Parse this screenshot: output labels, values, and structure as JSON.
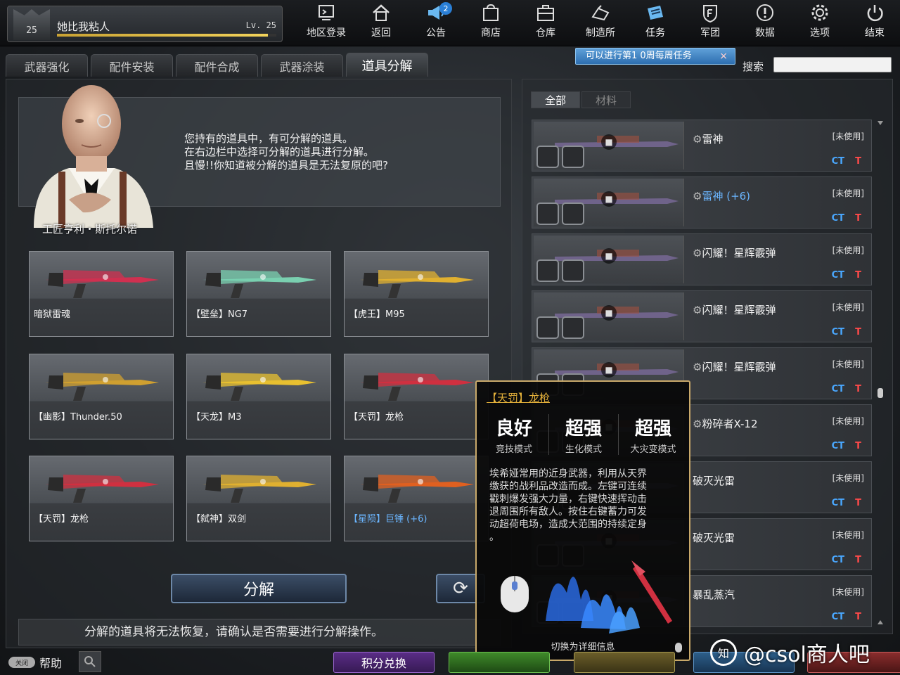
{
  "player": {
    "rank": "25",
    "name": "她比我粘人",
    "level": "Lv. 25",
    "xp_fraction": 0.96
  },
  "nav": [
    {
      "label": "地区登录",
      "icon": "server-login-icon"
    },
    {
      "label": "返回",
      "icon": "home-icon"
    },
    {
      "label": "公告",
      "icon": "megaphone-icon",
      "badge": "2"
    },
    {
      "label": "商店",
      "icon": "shop-icon"
    },
    {
      "label": "仓库",
      "icon": "inventory-icon"
    },
    {
      "label": "制造所",
      "icon": "crafting-icon"
    },
    {
      "label": "任务",
      "icon": "mission-icon"
    },
    {
      "label": "军团",
      "icon": "clan-icon"
    },
    {
      "label": "数据",
      "icon": "info-icon"
    },
    {
      "label": "选项",
      "icon": "gear-icon"
    },
    {
      "label": "结束",
      "icon": "power-icon"
    }
  ],
  "notice": {
    "text": "可以进行第1 0周每周任务",
    "close": "×"
  },
  "search": {
    "label": "搜索",
    "placeholder": ""
  },
  "subtabs": [
    "武器强化",
    "配件安装",
    "配件合成",
    "武器涂装",
    "道具分解"
  ],
  "npc": {
    "name": "工匠亨利・斯托尔诺",
    "lines": [
      "您持有的道具中，有可分解的道具。",
      "在右边栏中选择可分解的道具进行分解。",
      "且慢!!你知道被分解的道具是无法复原的吧?"
    ]
  },
  "items": [
    {
      "name": "暗狱雷魂",
      "color": "#d03050",
      "blue": false
    },
    {
      "name": "【壁垒】NG7",
      "color": "#7ad0b0",
      "blue": false
    },
    {
      "name": "【虎王】M95",
      "color": "#e0b030",
      "blue": false
    },
    {
      "name": "【幽影】Thunder.50",
      "color": "#d0a030",
      "blue": false
    },
    {
      "name": "【天龙】M3",
      "color": "#e8c030",
      "blue": false
    },
    {
      "name": "【天罚】龙枪",
      "color": "#d03040",
      "blue": false
    },
    {
      "name": "【天罚】龙枪",
      "color": "#d03040",
      "blue": false
    },
    {
      "name": "【弑神】双剑",
      "color": "#e0b030",
      "blue": false
    },
    {
      "name": "【星陨】巨锤 (+6)",
      "color": "#e06020",
      "blue": true
    }
  ],
  "buttons": {
    "decompose": "分解",
    "refresh": "⟳"
  },
  "warning": "分解的道具将无法恢复，请确认是否需要进行分解操作。",
  "right_tabs": [
    "全部",
    "材料"
  ],
  "list": [
    {
      "name": "雷神",
      "status": "[未使用]",
      "ct": "CT",
      "t": "T",
      "gear": true,
      "blue": false
    },
    {
      "name": "雷神 (+6)",
      "status": "[未使用]",
      "ct": "CT",
      "t": "T",
      "gear": true,
      "blue": true
    },
    {
      "name": "闪耀！星辉霰弹",
      "status": "[未使用]",
      "ct": "CT",
      "t": "T",
      "gear": true,
      "blue": false
    },
    {
      "name": "闪耀！星辉霰弹",
      "status": "[未使用]",
      "ct": "CT",
      "t": "T",
      "gear": true,
      "blue": false
    },
    {
      "name": "闪耀！星辉霰弹",
      "status": "[未使用]",
      "ct": "CT",
      "t": "T",
      "gear": true,
      "blue": false
    },
    {
      "name": "粉碎者X-12",
      "status": "[未使用]",
      "ct": "CT",
      "t": "T",
      "gear": true,
      "blue": false
    },
    {
      "name": "破灭光雷",
      "status": "[未使用]",
      "ct": "CT",
      "t": "T",
      "gear": false,
      "blue": false
    },
    {
      "name": "破灭光雷",
      "status": "[未使用]",
      "ct": "CT",
      "t": "T",
      "gear": false,
      "blue": false
    },
    {
      "name": "暴乱蒸汽",
      "status": "[未使用]",
      "ct": "CT",
      "t": "T",
      "gear": false,
      "blue": false
    }
  ],
  "tooltip": {
    "title": "【天罚】龙枪",
    "stats": [
      {
        "value": "良好",
        "mode": "竞技模式"
      },
      {
        "value": "超强",
        "mode": "生化模式"
      },
      {
        "value": "超强",
        "mode": "大灾变模式"
      }
    ],
    "desc": [
      "埃希娅常用的近身武器，利用从天界",
      "缴获的战利品改造而成。左键可连续",
      "戳刺爆发强大力量，右键快速挥动击",
      "退周围所有敌人。按住右键蓄力可发",
      "动超荷电场，造成大范围的持续定身",
      "。"
    ],
    "footer": "切换为详细信息"
  },
  "bottom": {
    "help_toggle": "关闭",
    "help": "帮助",
    "points": "积分兑换",
    "btn2": "",
    "btn3": "",
    "btn4": "",
    "btn5": ""
  },
  "watermark": {
    "logo": "知",
    "text": "@csol商人吧"
  }
}
